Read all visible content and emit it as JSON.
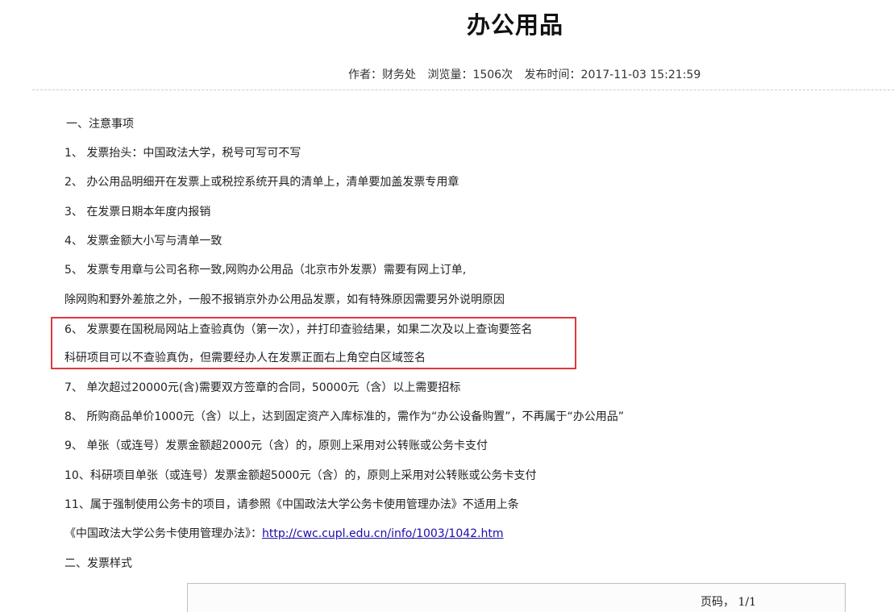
{
  "article": {
    "title": "办公用品",
    "meta": {
      "author": "作者：财务处",
      "views": "浏览量：1506次",
      "published": "发布时间：2017-11-03 15:21:59"
    },
    "section1_heading": "一、注意事项",
    "items": [
      "1、 发票抬头：中国政法大学，税号可写可不写",
      "2、 办公用品明细开在发票上或税控系统开具的清单上，清单要加盖发票专用章",
      "3、 在发票日期本年度内报销",
      "4、 发票金额大小写与清单一致",
      "5、 发票专用章与公司名称一致,网购办公用品（北京市外发票）需要有网上订单,",
      "除网购和野外差旅之外，一般不报销京外办公用品发票，如有特殊原因需要另外说明原因",
      "6、 发票要在国税局网站上查验真伪（第一次），并打印查验结果，如果二次及以上查询要签名",
      "科研项目可以不查验真伪，但需要经办人在发票正面右上角空白区域签名",
      "7、 单次超过20000元(含)需要双方签章的合同，50000元（含）以上需要招标",
      "8、 所购商品单价1000元（含）以上，达到固定资产入库标准的，需作为“办公设备购置”，不再属于“办公用品”",
      "9、 单张（或连号）发票金额超2000元（含）的，原则上采用对公转账或公务卡支付",
      "10、科研项目单张（或连号）发票金额超5000元（含）的，原则上采用对公转账或公务卡支付",
      "11、属于强制使用公务卡的项目，请参照《中国政法大学公务卡使用管理办法》不适用上条"
    ],
    "reference": {
      "prefix": "《中国政法大学公务卡使用管理办法》：",
      "link_text": "http://cwc.cupl.edu.cn/info/1003/1042.htm"
    },
    "section2_heading": "二、发票样式",
    "invoice_preview": {
      "page_label": "页码，  1/1"
    }
  },
  "colors": {
    "highlight_border": "#e0393e",
    "link": "#1a0dab"
  }
}
